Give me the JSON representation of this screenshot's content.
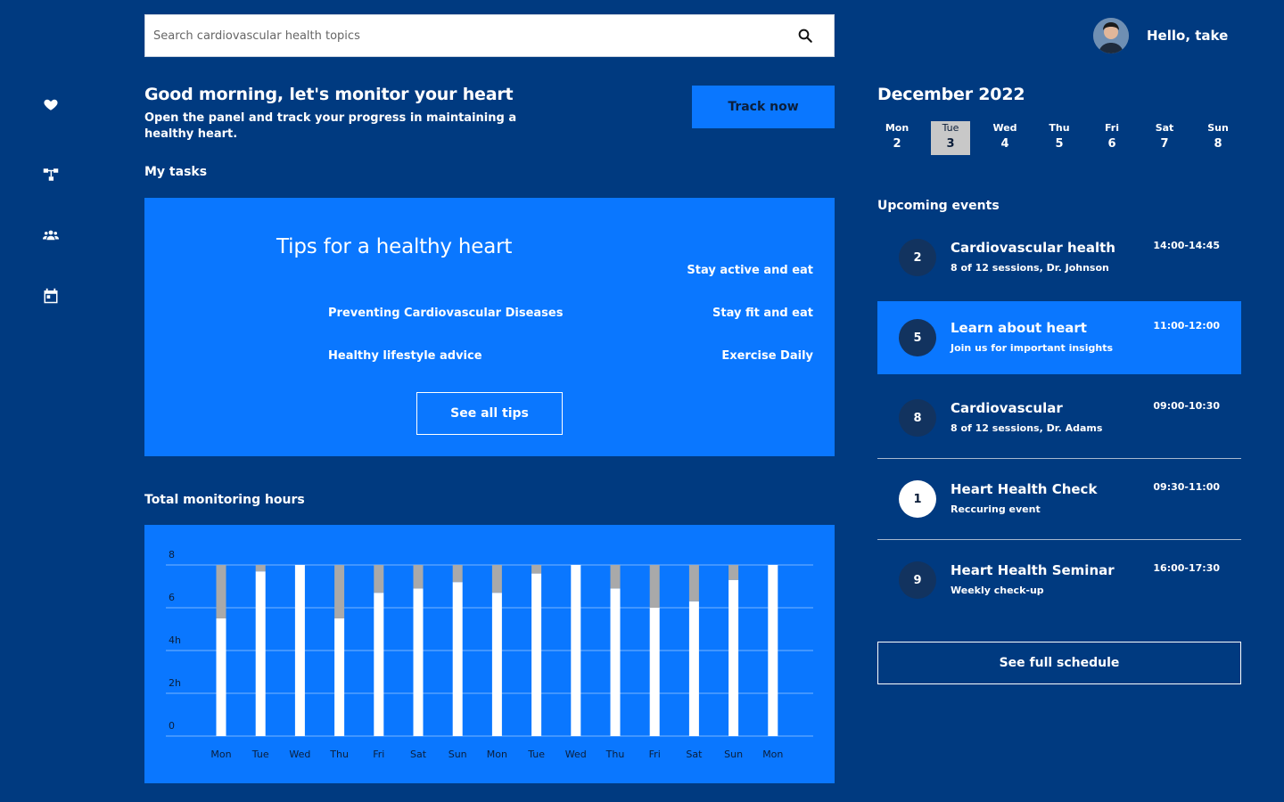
{
  "search": {
    "placeholder": "Search cardiovascular health topics"
  },
  "sidebar": {
    "icons": [
      "heart-icon",
      "hierarchy-icon",
      "users-icon",
      "calendar-icon"
    ]
  },
  "profile": {
    "greeting": "Hello, take"
  },
  "greeting": {
    "title": "Good morning, let's monitor your heart",
    "subtitle": "Open the panel and track your progress in maintaining a healthy heart.",
    "track_label": "Track now"
  },
  "tasks": {
    "section_title": "My tasks",
    "card_title": "Tips for a healthy heart",
    "tips_left": [
      "Preventing Cardiovascular Diseases",
      "Healthy lifestyle advice"
    ],
    "tips_right": [
      "Stay active and eat",
      "Stay fit and eat",
      "Exercise Daily"
    ],
    "see_all_label": "See all tips"
  },
  "monitoring": {
    "section_title": "Total monitoring hours"
  },
  "chart_data": {
    "type": "bar",
    "stacked": true,
    "categories": [
      "Mon",
      "Tue",
      "Wed",
      "Thu",
      "Fri",
      "Sat",
      "Sun",
      "Mon",
      "Tue",
      "Wed",
      "Thu",
      "Fri",
      "Sat",
      "Sun",
      "Mon"
    ],
    "series": [
      {
        "color": "#ffffff",
        "values": [
          5.5,
          7.7,
          8,
          5.5,
          6.7,
          6.9,
          7.2,
          6.7,
          7.6,
          8,
          6.9,
          6,
          6.3,
          7.3,
          8
        ]
      },
      {
        "color": "#a9a9a9",
        "values": [
          2.5,
          0.3,
          0,
          2.5,
          1.3,
          1.1,
          0.8,
          1.3,
          0.4,
          0,
          1.1,
          2,
          1.7,
          0.7,
          0
        ]
      }
    ],
    "ytick_labels": [
      "0",
      "2h",
      "4h",
      "6",
      "8"
    ],
    "ylim": [
      0,
      8
    ],
    "grid": true
  },
  "calendar": {
    "month_label": "December 2022",
    "days": [
      {
        "name": "Mon",
        "date": "2"
      },
      {
        "name": "Tue",
        "date": "3"
      },
      {
        "name": "Wed",
        "date": "4"
      },
      {
        "name": "Thu",
        "date": "5"
      },
      {
        "name": "Fri",
        "date": "6"
      },
      {
        "name": "Sat",
        "date": "7"
      },
      {
        "name": "Sun",
        "date": "8"
      }
    ],
    "selected_day": "Tue"
  },
  "events": {
    "section_title": "Upcoming events",
    "items": [
      {
        "num": "2",
        "title": "Cardiovascular health",
        "subtitle": "8 of 12 sessions, Dr. Johnson",
        "time": "14:00-14:45"
      },
      {
        "num": "5",
        "title": "Learn about heart",
        "subtitle": "Join us for important insights",
        "time": "11:00-12:00"
      },
      {
        "num": "8",
        "title": "Cardiovascular",
        "subtitle": "8 of 12 sessions, Dr. Adams",
        "time": "09:00-10:30"
      },
      {
        "num": "1",
        "title": "Heart Health Check",
        "subtitle": "Reccuring event",
        "time": "09:30-11:00"
      },
      {
        "num": "9",
        "title": "Heart Health Seminar",
        "subtitle": "Weekly check-up",
        "time": "16:00-17:30"
      }
    ],
    "see_schedule_label": "See full schedule"
  },
  "colors": {
    "background": "#003a80",
    "accent": "#0a77ff",
    "bar_primary": "#ffffff",
    "bar_secondary": "#a9a9a9",
    "selected_day": "#c8c8c8"
  }
}
